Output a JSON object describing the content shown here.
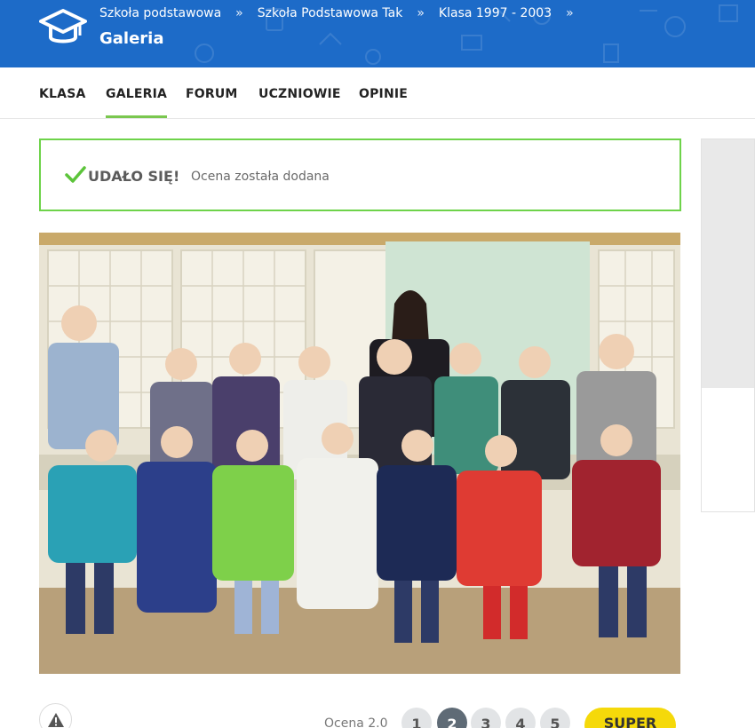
{
  "breadcrumbs": [
    "Szkoła podstawowa",
    "Szkoła Podstawowa Tak",
    "Klasa 1997 - 2003"
  ],
  "breadcrumb_separator": "»",
  "page_title": "Galeria",
  "tabs": [
    {
      "label": "KLASA"
    },
    {
      "label": "GALERIA"
    },
    {
      "label": "FORUM"
    },
    {
      "label": "UCZNIOWIE"
    },
    {
      "label": "OPINIE"
    }
  ],
  "active_tab": "GALERIA",
  "alert": {
    "title": "UDAŁO SIĘ!",
    "message": "Ocena została dodana"
  },
  "photo": {
    "description_icon": "class-photo"
  },
  "rating": {
    "label": "Ocena 2.0",
    "options": [
      "1",
      "2",
      "3",
      "4",
      "5"
    ],
    "selected": "2",
    "super_label": "SUPER"
  },
  "colors": {
    "header_bg": "#1d6bc8",
    "accent_green": "#7ac74f",
    "alert_border": "#6ed34a",
    "super_bg": "#f5d90a",
    "selected_rate": "#5f6b76"
  },
  "icons": {
    "logo": "graduation-cap-icon",
    "alert": "checkmark-icon",
    "report": "warning-icon"
  }
}
